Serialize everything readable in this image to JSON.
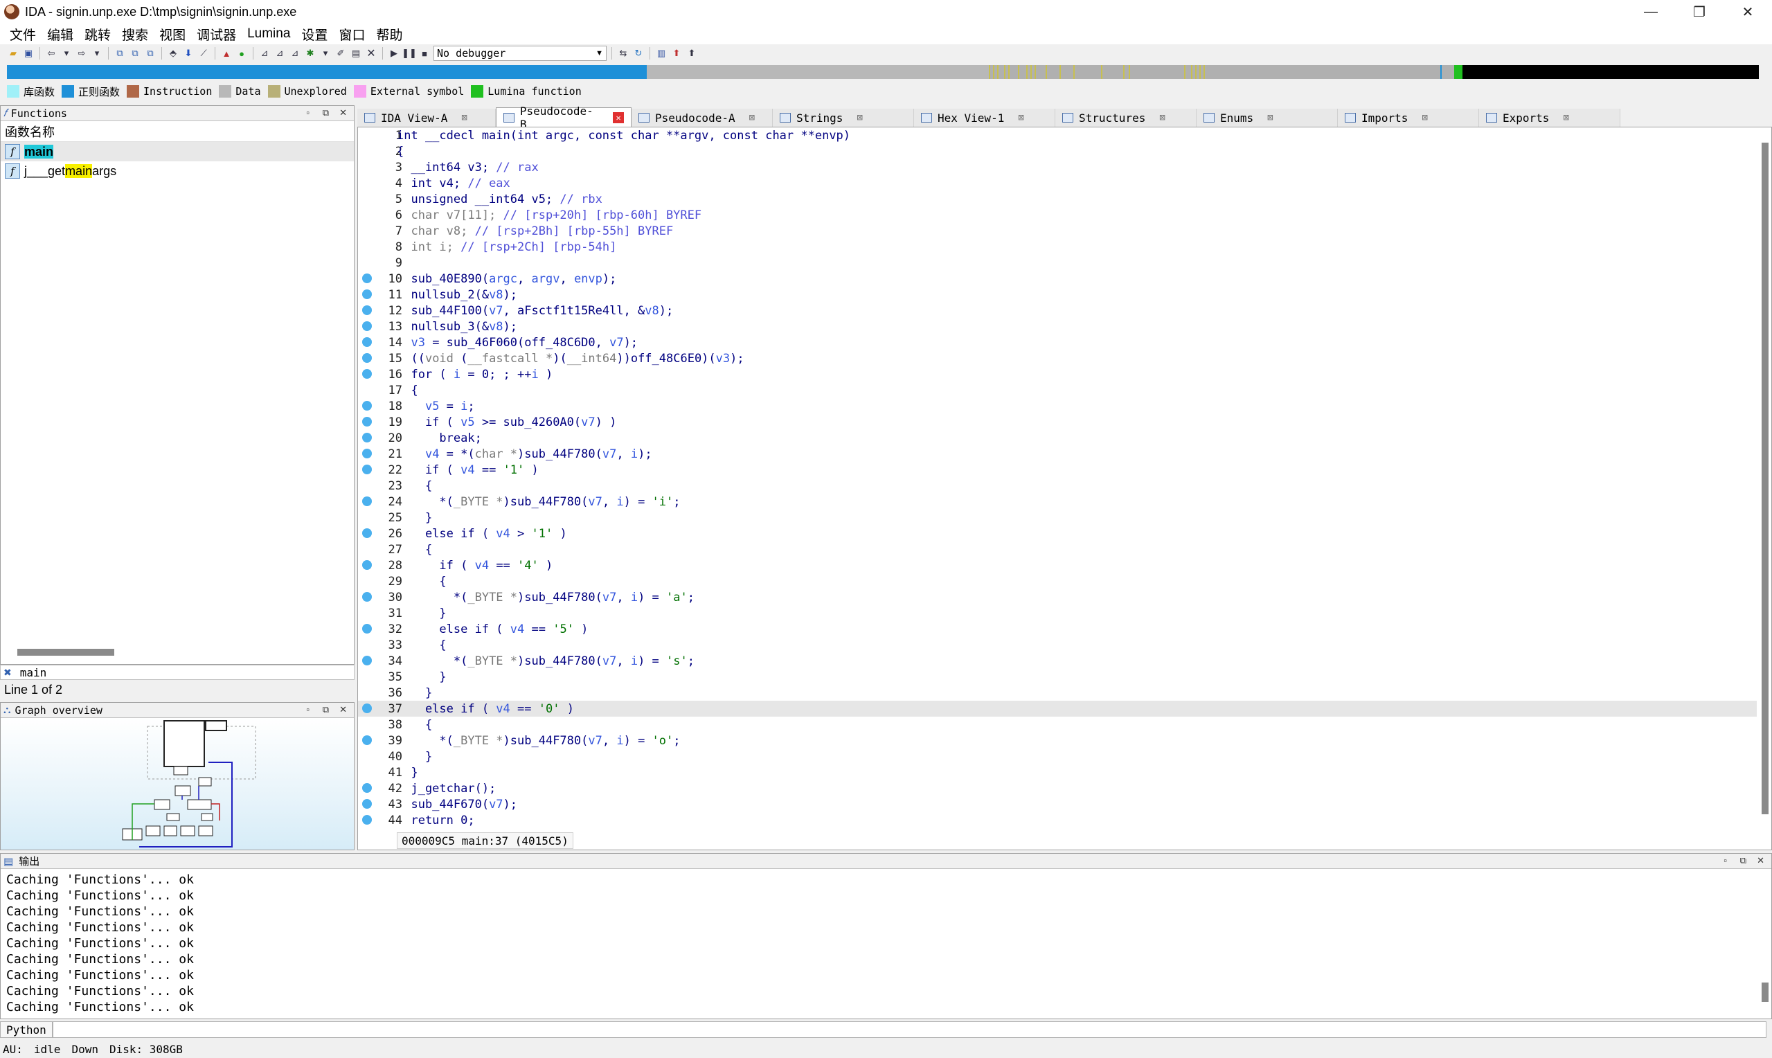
{
  "window": {
    "title": "IDA - signin.unp.exe D:\\tmp\\signin\\signin.unp.exe",
    "controls": [
      "—",
      "❐",
      "✕"
    ]
  },
  "menu": [
    "文件",
    "编辑",
    "跳转",
    "搜索",
    "视图",
    "调试器",
    "Lumina",
    "设置",
    "窗口",
    "帮助"
  ],
  "toolbar": {
    "debugger_select": "No debugger"
  },
  "legend": [
    {
      "label": "库函数",
      "color": "#a0f0f8"
    },
    {
      "label": "正则函数",
      "color": "#1e90d8"
    },
    {
      "label": "Instruction",
      "color": "#b06848"
    },
    {
      "label": "Data",
      "color": "#b8b8b8"
    },
    {
      "label": "Unexplored",
      "color": "#b8b078"
    },
    {
      "label": "External symbol",
      "color": "#f8a0f0"
    },
    {
      "label": "Lumina function",
      "color": "#20c020"
    }
  ],
  "functions_panel": {
    "title": "Functions",
    "column": "函数名称",
    "rows": [
      {
        "pre": "",
        "hl": "main",
        "post": "",
        "selected": true
      },
      {
        "pre": "j___get",
        "hl": "main",
        "post": "args",
        "selected": false
      }
    ],
    "filter": "main",
    "line_info": "Line 1 of 2"
  },
  "graph_overview": {
    "title": "Graph overview"
  },
  "tabs": [
    {
      "label": "IDA View-A",
      "active": false
    },
    {
      "label": "Pseudocode-B",
      "active": true
    },
    {
      "label": "Pseudocode-A",
      "active": false
    },
    {
      "label": "Strings",
      "active": false
    },
    {
      "label": "Hex View-1",
      "active": false
    },
    {
      "label": "Structures",
      "active": false
    },
    {
      "label": "Enums",
      "active": false
    },
    {
      "label": "Imports",
      "active": false
    },
    {
      "label": "Exports",
      "active": false
    }
  ],
  "code": {
    "current_line": 37,
    "status": "000009C5 main:37 (4015C5)"
  },
  "output": {
    "title": "输出",
    "lines": [
      "Caching 'Functions'... ok",
      "Caching 'Functions'... ok",
      "Caching 'Functions'... ok",
      "Caching 'Functions'... ok",
      "Caching 'Functions'... ok",
      "Caching 'Functions'... ok",
      "Caching 'Functions'... ok",
      "Caching 'Functions'... ok",
      "Caching 'Functions'... ok"
    ],
    "python_label": "Python"
  },
  "status": {
    "au": "AU:",
    "au_state": "idle",
    "direction": "Down",
    "disk": "Disk: 308GB"
  }
}
